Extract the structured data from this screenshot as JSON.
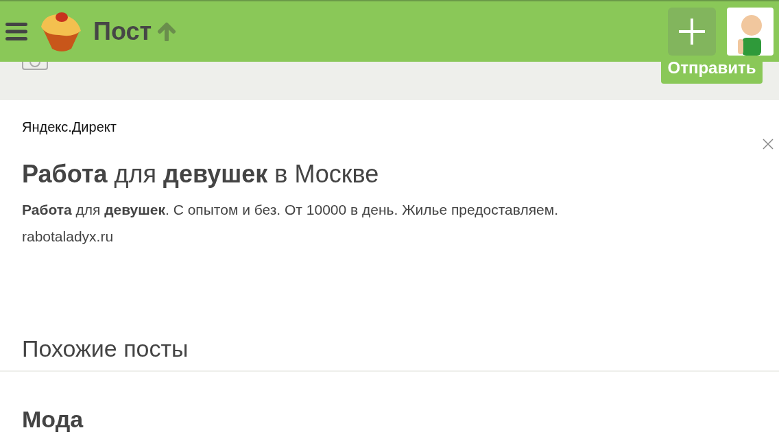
{
  "header": {
    "title": "Пост"
  },
  "comment_form": {
    "submit_button": "Отправить"
  },
  "ad": {
    "source": "Яндекс.Директ",
    "title": "**Работа** для **девушек** в Москве",
    "text": "**Работа** для **девушек**. С опытом и без. От 10000 в день. Жилье предоставляем.",
    "url": "rabotaladyx.ru"
  },
  "related": {
    "heading": "Похожие посты",
    "posts": [
      {
        "title": "Мода"
      }
    ]
  }
}
